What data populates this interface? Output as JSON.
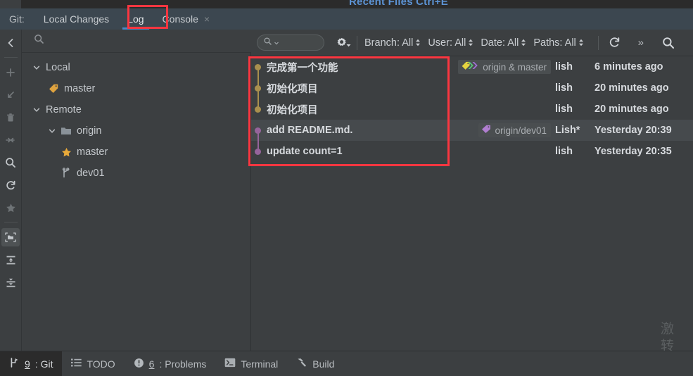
{
  "window": {
    "overlay_hint": "Recent Files Ctrl+E",
    "accent_blue": "#4a88c7",
    "annotation_red": "#fb3640",
    "bg": "#3c3f41",
    "tabbar_bg": "#3c4750"
  },
  "tabbar": {
    "git_label": "Git:",
    "tabs": [
      {
        "label": "Local Changes",
        "active": false,
        "closable": false
      },
      {
        "label": "Log",
        "active": true,
        "closable": false
      },
      {
        "label": "Console",
        "active": false,
        "closable": true,
        "close_glyph": "×"
      }
    ]
  },
  "rail": {
    "items": [
      {
        "name": "collapse-left-icon",
        "title": "Hide"
      },
      {
        "name": "add-icon",
        "title": "Add"
      },
      {
        "name": "revert-icon",
        "title": "Revert"
      },
      {
        "name": "delete-icon",
        "title": "Delete"
      },
      {
        "name": "compare-icon",
        "title": "Compare"
      },
      {
        "name": "search-icon",
        "title": "Search"
      },
      {
        "name": "refresh-icon",
        "title": "Refresh"
      },
      {
        "name": "star-icon",
        "title": "Favorite"
      },
      {
        "name": "folder-group-icon",
        "title": "Group by directory",
        "selected": true
      },
      {
        "name": "expand-all-icon",
        "title": "Expand All"
      },
      {
        "name": "collapse-all-icon",
        "title": "Collapse All"
      }
    ]
  },
  "branch_panel": {
    "search_placeholder": "",
    "search_value": "",
    "tree": [
      {
        "label": "Local",
        "indent": 0,
        "chevron": "down",
        "icon": "none"
      },
      {
        "label": "master",
        "indent": 1,
        "chevron": "none",
        "icon": "tag-yellow"
      },
      {
        "label": "Remote",
        "indent": 0,
        "chevron": "down",
        "icon": "none"
      },
      {
        "label": "origin",
        "indent": 1,
        "chevron": "down",
        "icon": "folder"
      },
      {
        "label": "master",
        "indent": 2,
        "chevron": "none",
        "icon": "star-yellow"
      },
      {
        "label": "dev01",
        "indent": 2,
        "chevron": "none",
        "icon": "branch"
      }
    ]
  },
  "log_toolbar": {
    "search_placeholder": "",
    "search_value": "",
    "gear_name": "settings-gear-icon",
    "filters": [
      {
        "label": "Branch: All"
      },
      {
        "label": "User: All"
      },
      {
        "label": "Date: All"
      },
      {
        "label": "Paths: All"
      }
    ],
    "refresh_name": "refresh-icon",
    "overflow_label": "»",
    "search_icon_name": "search-icon"
  },
  "commits": {
    "rows": [
      {
        "subject": "完成第一个功能",
        "refs": [
          {
            "text": "origin & master",
            "icon": "tag-multi"
          }
        ],
        "author": "lish",
        "date": "6 minutes ago",
        "dot_color": "#a98f4e",
        "line_down": true,
        "line_up": false,
        "selected": false
      },
      {
        "subject": "初始化项目",
        "refs": [],
        "author": "lish",
        "date": "20 minutes ago",
        "dot_color": "#a98f4e",
        "line_down": true,
        "line_up": true,
        "selected": false
      },
      {
        "subject": "初始化项目",
        "refs": [],
        "author": "lish",
        "date": "20 minutes ago",
        "dot_color": "#a98f4e",
        "line_down": false,
        "line_up": true,
        "selected": false
      },
      {
        "subject": "add README.md.",
        "refs": [
          {
            "text": "origin/dev01",
            "icon": "tag-purple"
          }
        ],
        "author": "Lish*",
        "date": "Yesterday 20:39",
        "dot_color": "#96649b",
        "line_down": true,
        "line_up": false,
        "selected": true
      },
      {
        "subject": "update count=1",
        "refs": [],
        "author": "lish",
        "date": "Yesterday 20:35",
        "dot_color": "#96649b",
        "line_down": false,
        "line_up": true,
        "selected": false
      }
    ]
  },
  "watermark": {
    "line1": "激",
    "line2": "转"
  },
  "statusbar": {
    "items": [
      {
        "label_prefix": "9",
        "label": ": Git",
        "icon": "branch-icon",
        "active": true
      },
      {
        "label_prefix": "",
        "label": "TODO",
        "icon": "list-icon",
        "active": false
      },
      {
        "label_prefix": "6",
        "label": ": Problems",
        "icon": "warning-icon",
        "active": false
      },
      {
        "label_prefix": "",
        "label": "Terminal",
        "icon": "terminal-icon",
        "active": false
      },
      {
        "label_prefix": "",
        "label": "Build",
        "icon": "hammer-icon",
        "active": false
      }
    ]
  }
}
